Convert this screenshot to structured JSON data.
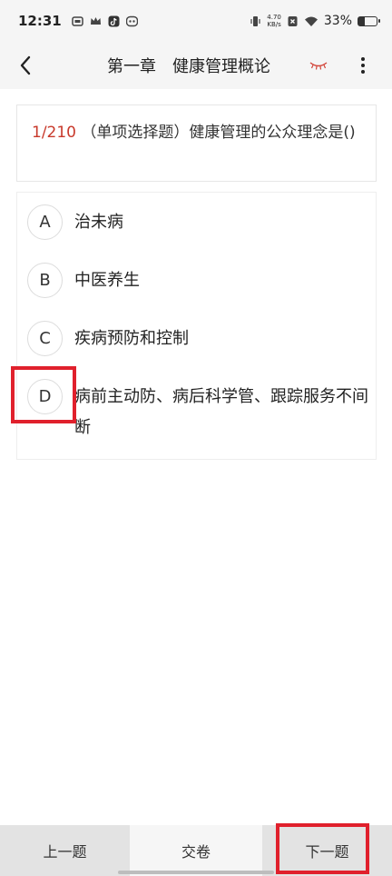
{
  "status_bar": {
    "time": "12:31",
    "net_speed_value": "4.70",
    "net_speed_unit": "KB/s",
    "battery_percent": "33%",
    "battery_level": 0.33
  },
  "header": {
    "title": "第一章　健康管理概论"
  },
  "question": {
    "number": "1/210",
    "text": " （单项选择题）健康管理的公众理念是()"
  },
  "options": [
    {
      "letter": "A",
      "text": "治未病"
    },
    {
      "letter": "B",
      "text": "中医养生"
    },
    {
      "letter": "C",
      "text": "疾病预防和控制"
    },
    {
      "letter": "D",
      "text": "病前主动防、病后科学管、跟踪服务不间断"
    }
  ],
  "bottom": {
    "prev_label": "上一题",
    "submit_label": "交卷",
    "next_label": "下一题"
  },
  "colors": {
    "accent": "#c8392b",
    "highlight": "#e0202c"
  }
}
